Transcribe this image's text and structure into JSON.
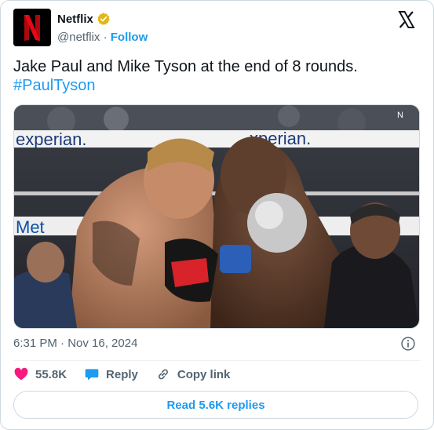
{
  "author": {
    "display_name": "Netflix",
    "handle": "@netflix",
    "separator": "·",
    "follow_label": "Follow",
    "verified_color": "#E2B719",
    "avatar_icon": "netflix-logo-icon"
  },
  "tweet": {
    "text": "Jake Paul and Mike Tyson at the end of 8 rounds.",
    "hashtag": "#PaulTyson",
    "timestamp": "6:31 PM · Nov 16, 2024"
  },
  "media": {
    "banner_text_top_left": "experian.",
    "banner_text_top_right": "xperian.",
    "banner_text_lower": "Met",
    "corner_letter": "N"
  },
  "actions": {
    "like_count": "55.8K",
    "reply_label": "Reply",
    "copy_link_label": "Copy link",
    "read_replies_label": "Read 5.6K replies"
  },
  "colors": {
    "link": "#1d9bf0",
    "like": "#f91880",
    "reply": "#1d9bf0",
    "muted": "#536471"
  }
}
